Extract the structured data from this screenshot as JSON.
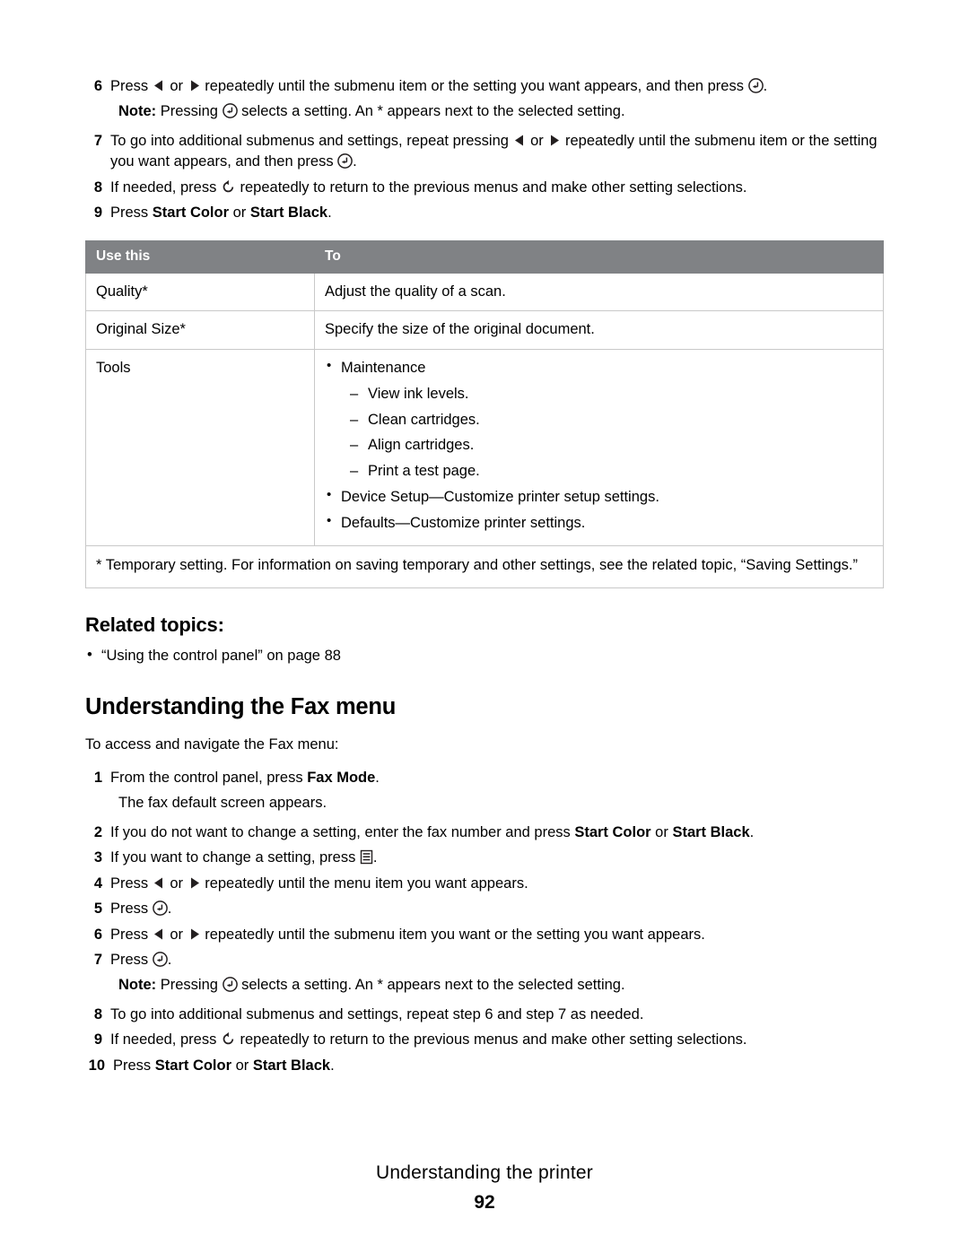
{
  "steps_top": [
    {
      "num": "6",
      "parts": [
        {
          "t": "text",
          "v": "Press "
        },
        {
          "t": "icon",
          "v": "arrow-left-icon"
        },
        {
          "t": "text",
          "v": " or "
        },
        {
          "t": "icon",
          "v": "arrow-right-icon"
        },
        {
          "t": "text",
          "v": " repeatedly until the submenu item or the setting you want appears, and then press "
        },
        {
          "t": "icon",
          "v": "select-icon"
        },
        {
          "t": "text",
          "v": "."
        }
      ]
    },
    {
      "num": "7",
      "parts": [
        {
          "t": "text",
          "v": "To go into additional submenus and settings, repeat pressing "
        },
        {
          "t": "icon",
          "v": "arrow-left-icon"
        },
        {
          "t": "text",
          "v": " or "
        },
        {
          "t": "icon",
          "v": "arrow-right-icon"
        },
        {
          "t": "text",
          "v": " repeatedly until the submenu item or the setting you want appears, and then press "
        },
        {
          "t": "icon",
          "v": "select-icon"
        },
        {
          "t": "text",
          "v": "."
        }
      ]
    },
    {
      "num": "8",
      "parts": [
        {
          "t": "text",
          "v": "If needed, press "
        },
        {
          "t": "icon",
          "v": "back-icon"
        },
        {
          "t": "text",
          "v": " repeatedly to return to the previous menus and make other setting selections."
        }
      ]
    },
    {
      "num": "9",
      "parts": [
        {
          "t": "text",
          "v": "Press "
        },
        {
          "t": "bold",
          "v": "Start Color"
        },
        {
          "t": "text",
          "v": " or "
        },
        {
          "t": "bold",
          "v": "Start Black"
        },
        {
          "t": "text",
          "v": "."
        }
      ]
    }
  ],
  "note_top": {
    "label": "Note:",
    "before": " Pressing ",
    "icon": "select-icon",
    "after": " selects a setting. An * appears next to the selected setting."
  },
  "table": {
    "headers": [
      "Use this",
      "To"
    ],
    "rows": [
      {
        "use": "Quality*",
        "to_text": "Adjust the quality of a scan.",
        "to_list": []
      },
      {
        "use": "Original Size*",
        "to_text": "Specify the size of the original document.",
        "to_list": []
      },
      {
        "use": "Tools",
        "to_text": "",
        "to_list": [
          {
            "level": 1,
            "text": "Maintenance"
          },
          {
            "level": 2,
            "text": "View ink levels."
          },
          {
            "level": 2,
            "text": "Clean cartridges."
          },
          {
            "level": 2,
            "text": "Align cartridges."
          },
          {
            "level": 2,
            "text": "Print a test page."
          },
          {
            "level": 1,
            "text": "Device Setup—Customize printer setup settings."
          },
          {
            "level": 1,
            "text": "Defaults—Customize printer settings."
          }
        ]
      }
    ],
    "footnote": "* Temporary setting. For information on saving temporary and other settings, see the related topic, “Saving Settings.”"
  },
  "related": {
    "heading": "Related topics:",
    "items": [
      "“Using the control panel” on page 88"
    ]
  },
  "section": {
    "heading": "Understanding the Fax menu",
    "intro": "To access and navigate the Fax menu:"
  },
  "steps_fax": [
    {
      "num": "1",
      "parts": [
        {
          "t": "text",
          "v": "From the control panel, press "
        },
        {
          "t": "bold",
          "v": "Fax Mode"
        },
        {
          "t": "text",
          "v": "."
        }
      ],
      "sub": "The fax default screen appears."
    },
    {
      "num": "2",
      "parts": [
        {
          "t": "text",
          "v": "If you do not want to change a setting, enter the fax number and press "
        },
        {
          "t": "bold",
          "v": "Start Color"
        },
        {
          "t": "text",
          "v": " or "
        },
        {
          "t": "bold",
          "v": "Start Black"
        },
        {
          "t": "text",
          "v": "."
        }
      ]
    },
    {
      "num": "3",
      "parts": [
        {
          "t": "text",
          "v": "If you want to change a setting, press "
        },
        {
          "t": "icon",
          "v": "menu-icon"
        },
        {
          "t": "text",
          "v": "."
        }
      ]
    },
    {
      "num": "4",
      "parts": [
        {
          "t": "text",
          "v": "Press "
        },
        {
          "t": "icon",
          "v": "arrow-left-icon"
        },
        {
          "t": "text",
          "v": " or "
        },
        {
          "t": "icon",
          "v": "arrow-right-icon"
        },
        {
          "t": "text",
          "v": " repeatedly until the menu item you want appears."
        }
      ]
    },
    {
      "num": "5",
      "parts": [
        {
          "t": "text",
          "v": "Press "
        },
        {
          "t": "icon",
          "v": "select-icon"
        },
        {
          "t": "text",
          "v": "."
        }
      ]
    },
    {
      "num": "6",
      "parts": [
        {
          "t": "text",
          "v": "Press "
        },
        {
          "t": "icon",
          "v": "arrow-left-icon"
        },
        {
          "t": "text",
          "v": " or "
        },
        {
          "t": "icon",
          "v": "arrow-right-icon"
        },
        {
          "t": "text",
          "v": " repeatedly until the submenu item you want or the setting you want appears."
        }
      ]
    },
    {
      "num": "7",
      "parts": [
        {
          "t": "text",
          "v": "Press "
        },
        {
          "t": "icon",
          "v": "select-icon"
        },
        {
          "t": "text",
          "v": "."
        }
      ]
    }
  ],
  "note_fax": {
    "label": "Note:",
    "before": " Pressing ",
    "icon": "select-icon",
    "after": " selects a setting. An * appears next to the selected setting."
  },
  "steps_fax_tail": [
    {
      "num": "8",
      "parts": [
        {
          "t": "text",
          "v": "To go into additional submenus and settings, repeat step 6 and step 7 as needed."
        }
      ]
    },
    {
      "num": "9",
      "parts": [
        {
          "t": "text",
          "v": "If needed, press "
        },
        {
          "t": "icon",
          "v": "back-icon"
        },
        {
          "t": "text",
          "v": " repeatedly to return to the previous menus and make other setting selections."
        }
      ]
    },
    {
      "num": "10",
      "parts": [
        {
          "t": "text",
          "v": "Press "
        },
        {
          "t": "bold",
          "v": "Start Color"
        },
        {
          "t": "text",
          "v": " or "
        },
        {
          "t": "bold",
          "v": "Start Black"
        },
        {
          "t": "text",
          "v": "."
        }
      ]
    }
  ],
  "footer": {
    "title": "Understanding the printer",
    "page": "92"
  },
  "colors": {
    "header_bg": "#808285",
    "border": "#c9c9c9"
  }
}
